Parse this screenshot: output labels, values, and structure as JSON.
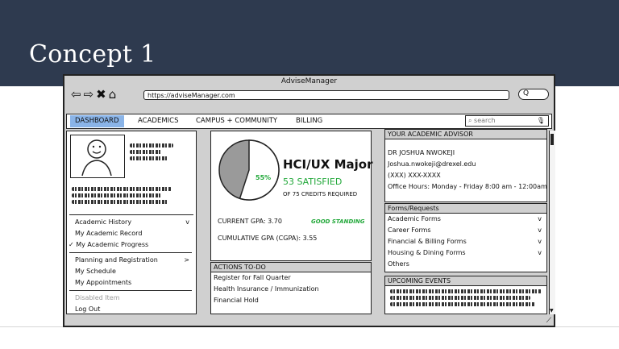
{
  "slide": {
    "title": "Concept 1"
  },
  "browser": {
    "window_title": "AdviseManager",
    "url": "https://adviseManager.com",
    "search_glyph": "Q"
  },
  "tabs": [
    {
      "label": "DASHBOARD",
      "active": true
    },
    {
      "label": "ACADEMICS",
      "active": false
    },
    {
      "label": "CAMPUS + COMMUNITY",
      "active": false
    },
    {
      "label": "BILLING",
      "active": false
    }
  ],
  "search": {
    "placeholder": "search"
  },
  "menu": {
    "items": [
      {
        "label": "Academic History",
        "suffix": "v"
      },
      {
        "label": "My Academic Record",
        "suffix": ""
      },
      {
        "label": "My Academic Progress",
        "suffix": "",
        "checked": true
      },
      {
        "label": "Planning and Registration",
        "suffix": ">"
      },
      {
        "label": "My Schedule",
        "suffix": ""
      },
      {
        "label": "My Appointments",
        "suffix": ""
      },
      {
        "label": "Disabled Item",
        "suffix": "",
        "disabled": true
      },
      {
        "label": "Log Out",
        "suffix": ""
      }
    ]
  },
  "progress": {
    "percent_label": "55%",
    "fraction": 0.55,
    "major": "HCI/UX Major",
    "satisfied": "53 SATISFIED",
    "required": "OF 75 CREDITS REQUIRED",
    "current_gpa": "CURRENT GPA:  3.70",
    "standing": "GOOD STANDING",
    "cumulative_gpa": "CUMULATIVE GPA (CGPA): 3.55"
  },
  "actions": {
    "title": "ACTIONS TO-DO",
    "items": [
      "Register for Fall Quarter",
      "Health Insurance / Immunization",
      "Financial Hold"
    ]
  },
  "advisor": {
    "title": "YOUR ACADEMIC ADVISOR",
    "name": "DR JOSHUA NWOKEJI",
    "email": "Joshua.nwokeji@drexel.edu",
    "phone": "(XXX) XXX-XXXX",
    "hours": "Office Hours: Monday - Friday 8:00 am - 12:00am"
  },
  "forms": {
    "title": "Forms/Requests",
    "items": [
      {
        "label": "Academic Forms",
        "suffix": "v"
      },
      {
        "label": "Career Forms",
        "suffix": "v"
      },
      {
        "label": "Financial & Billing Forms",
        "suffix": "v"
      },
      {
        "label": "Housing & Dining Forms",
        "suffix": "v"
      },
      {
        "label": "Others",
        "suffix": ""
      }
    ]
  },
  "events": {
    "title": "UPCOMING EVENTS"
  },
  "colors": {
    "header": "#2e3a4f",
    "active_tab": "#8ab4e8",
    "green": "#22a83a",
    "gray": "#d0d0d0"
  }
}
